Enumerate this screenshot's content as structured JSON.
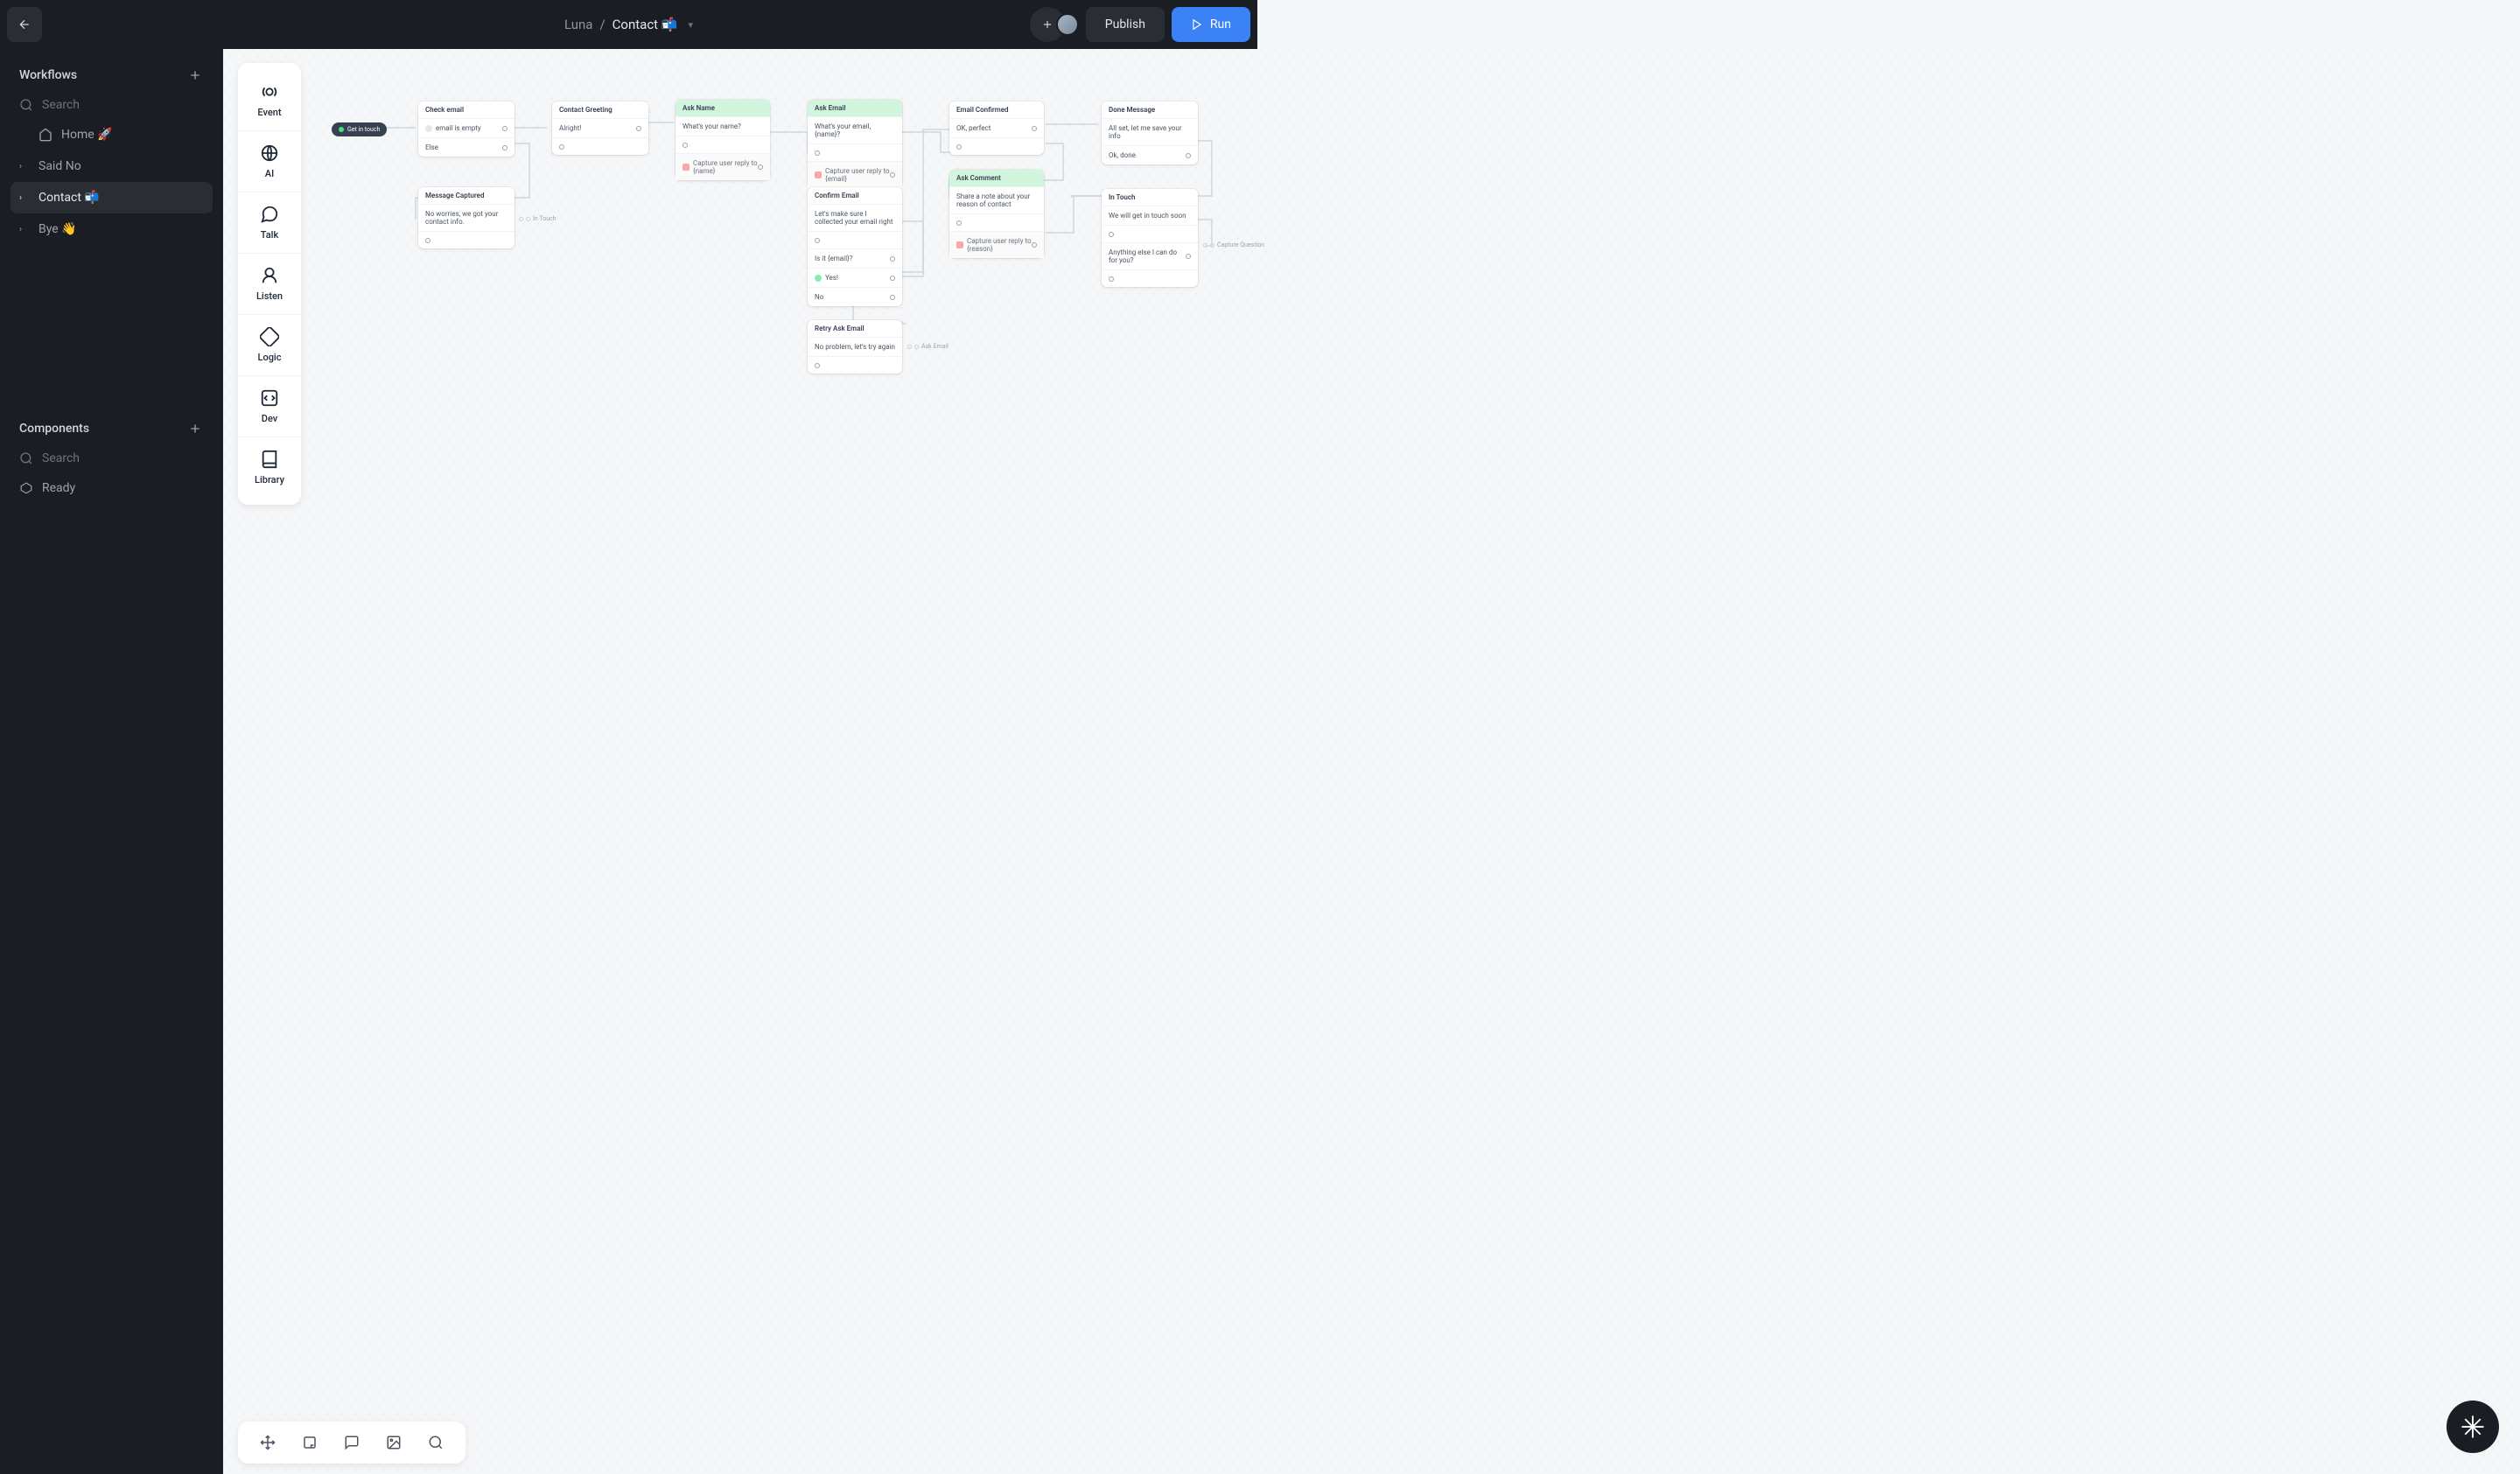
{
  "header": {
    "breadcrumb_parent": "Luna",
    "breadcrumb_sep": "/",
    "breadcrumb_current": "Contact 📬",
    "publish_label": "Publish",
    "run_label": "Run"
  },
  "sidebar": {
    "workflows_title": "Workflows",
    "search_placeholder": "Search",
    "items": [
      {
        "label": "Home 🚀",
        "icon": "home",
        "active": false,
        "expandable": false
      },
      {
        "label": "Said No",
        "icon": "",
        "active": false,
        "expandable": true
      },
      {
        "label": "Contact 📬",
        "icon": "",
        "active": true,
        "expandable": true
      },
      {
        "label": "Bye 👋",
        "icon": "",
        "active": false,
        "expandable": true
      }
    ],
    "components_title": "Components",
    "components_search": "Search",
    "components_items": [
      {
        "label": "Ready"
      }
    ]
  },
  "toolbox": [
    {
      "name": "event",
      "label": "Event"
    },
    {
      "name": "ai",
      "label": "AI"
    },
    {
      "name": "talk",
      "label": "Talk"
    },
    {
      "name": "listen",
      "label": "Listen"
    },
    {
      "name": "logic",
      "label": "Logic"
    },
    {
      "name": "dev",
      "label": "Dev"
    },
    {
      "name": "library",
      "label": "Library"
    }
  ],
  "canvas": {
    "start_pill": "Get in touch",
    "cards": {
      "check_email": {
        "title": "Check email",
        "rows": [
          "email is empty",
          "Else"
        ]
      },
      "contact_greeting": {
        "title": "Contact Greeting",
        "rows": [
          "Alright!"
        ]
      },
      "ask_name": {
        "title": "Ask Name",
        "rows": [
          "What's your name?"
        ],
        "capture": "Capture user reply to {name}"
      },
      "ask_email": {
        "title": "Ask Email",
        "rows": [
          "What's your email, {name}?"
        ],
        "capture": "Capture user reply to {email}"
      },
      "email_confirmed": {
        "title": "Email Confirmed",
        "rows": [
          "OK, perfect"
        ]
      },
      "done_message": {
        "title": "Done Message",
        "rows": [
          "All set, let me save your info",
          "Ok, done"
        ]
      },
      "ask_comment": {
        "title": "Ask Comment",
        "rows": [
          "Share a note about your reason of contact"
        ],
        "capture": "Capture user reply to {reason}"
      },
      "message_captured": {
        "title": "Message Captured",
        "rows": [
          "No worries, we got your contact info."
        ]
      },
      "confirm_email": {
        "title": "Confirm Email",
        "rows": [
          "Let's make sure I collected your email right",
          "Is it {email}?",
          "Yes!",
          "No"
        ]
      },
      "in_touch": {
        "title": "In Touch",
        "rows": [
          "We will get in touch soon",
          "Anything else I can do for you?"
        ]
      },
      "retry_ask_email": {
        "title": "Retry Ask Email",
        "rows": [
          "No problem, let's try again"
        ]
      }
    },
    "labels": {
      "in_touch_badge": "In Touch",
      "ask_email_badge": "Ask Email",
      "capture_question_badge": "Capture Question"
    }
  }
}
